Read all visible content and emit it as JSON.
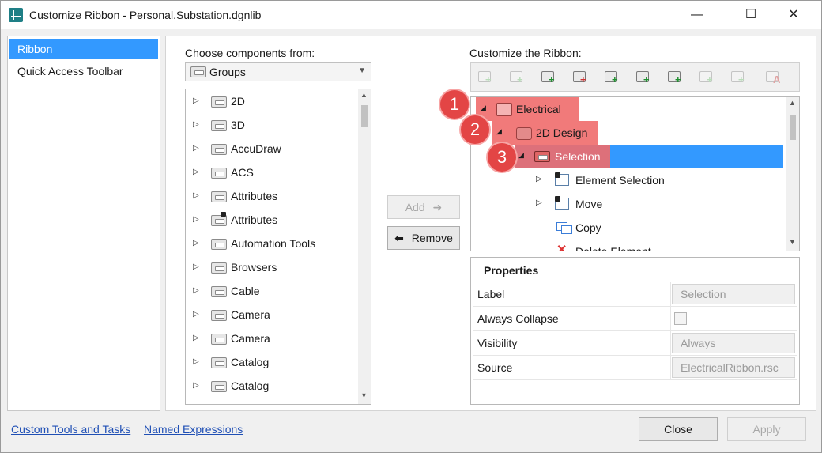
{
  "window": {
    "title": "Customize Ribbon - Personal.Substation.dgnlib",
    "minimize": "—",
    "maximize": "☐",
    "close": "✕"
  },
  "sidebar": {
    "items": [
      {
        "label": "Ribbon",
        "selected": true
      },
      {
        "label": "Quick Access Toolbar",
        "selected": false
      }
    ]
  },
  "left": {
    "heading": "Choose components from:",
    "combo_value": "Groups",
    "items": [
      {
        "label": "2D",
        "locked": false
      },
      {
        "label": "3D",
        "locked": false
      },
      {
        "label": "AccuDraw",
        "locked": false
      },
      {
        "label": "ACS",
        "locked": false
      },
      {
        "label": "Attributes",
        "locked": false
      },
      {
        "label": "Attributes",
        "locked": true
      },
      {
        "label": "Automation Tools",
        "locked": false
      },
      {
        "label": "Browsers",
        "locked": false
      },
      {
        "label": "Cable",
        "locked": false
      },
      {
        "label": "Camera",
        "locked": false
      },
      {
        "label": "Camera",
        "locked": false
      },
      {
        "label": "Catalog",
        "locked": false
      },
      {
        "label": "Catalog",
        "locked": false
      }
    ]
  },
  "middle": {
    "add_label": "Add",
    "remove_label": "Remove"
  },
  "right": {
    "heading": "Customize the Ribbon:",
    "tree": [
      {
        "label": "Electrical",
        "level": 0,
        "badge": "1"
      },
      {
        "label": "2D Design",
        "level": 1,
        "badge": "2"
      },
      {
        "label": "Selection",
        "level": 2,
        "badge": "3"
      },
      {
        "label": "Element Selection",
        "level": 3
      },
      {
        "label": "Move",
        "level": 3
      },
      {
        "label": "Copy",
        "level": 3
      },
      {
        "label": "Delete Element",
        "level": 3
      }
    ]
  },
  "properties": {
    "heading": "Properties",
    "rows": [
      {
        "name": "Label",
        "value": "Selection"
      },
      {
        "name": "Always Collapse",
        "value": ""
      },
      {
        "name": "Visibility",
        "value": "Always"
      },
      {
        "name": "Source",
        "value": "ElectricalRibbon.rsc"
      }
    ]
  },
  "footer": {
    "link1": "Custom Tools and Tasks",
    "link2": "Named Expressions",
    "close_label": "Close",
    "apply_label": "Apply"
  },
  "colors": {
    "selection": "#3399ff",
    "highlight": "#f06b6b",
    "badge": "#e34545"
  }
}
